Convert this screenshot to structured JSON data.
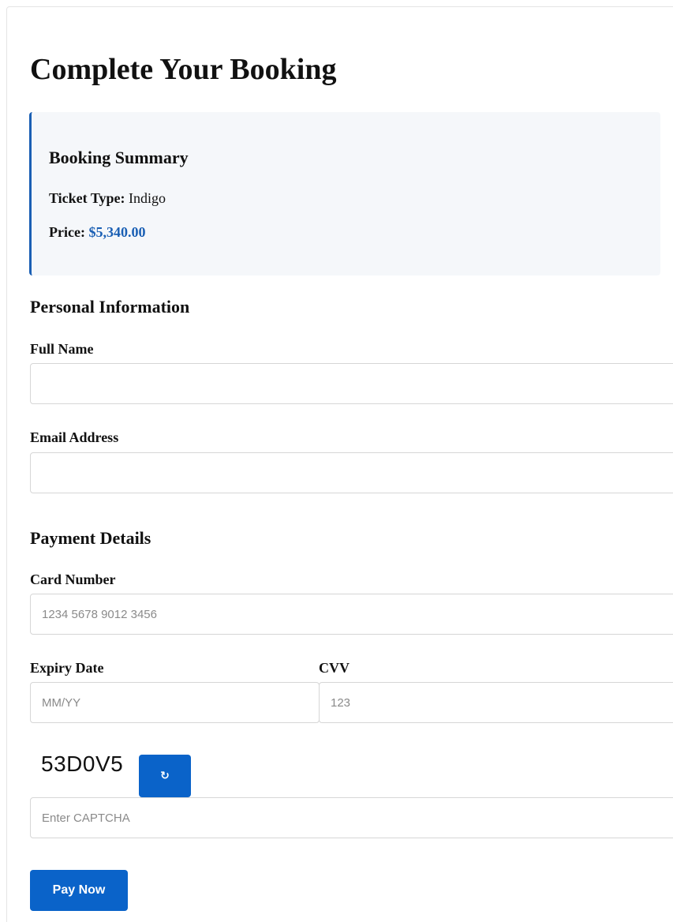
{
  "page": {
    "title": "Complete Your Booking"
  },
  "summary": {
    "title": "Booking Summary",
    "ticket_type_label": "Ticket Type:",
    "ticket_type_value": "Indigo",
    "price_label": "Price:",
    "price_value": "$5,340.00"
  },
  "personal": {
    "heading": "Personal Information",
    "full_name_label": "Full Name",
    "full_name_value": "",
    "full_name_placeholder": "",
    "email_label": "Email Address",
    "email_value": "",
    "email_placeholder": ""
  },
  "payment": {
    "heading": "Payment Details",
    "card_label": "Card Number",
    "card_placeholder": "1234 5678 9012 3456",
    "expiry_label": "Expiry Date",
    "expiry_placeholder": "MM/YY",
    "cvv_label": "CVV",
    "cvv_placeholder": "123"
  },
  "captcha": {
    "code": "53D0V5",
    "refresh_icon": "↻",
    "refresh_icon_name": "refresh-icon",
    "input_placeholder": "Enter CAPTCHA"
  },
  "actions": {
    "pay_label": "Pay Now"
  },
  "colors": {
    "accent": "#0a63c9",
    "summary_border": "#1a5fb4",
    "summary_bg": "#f5f7fa",
    "price_text": "#1a5fb4"
  }
}
